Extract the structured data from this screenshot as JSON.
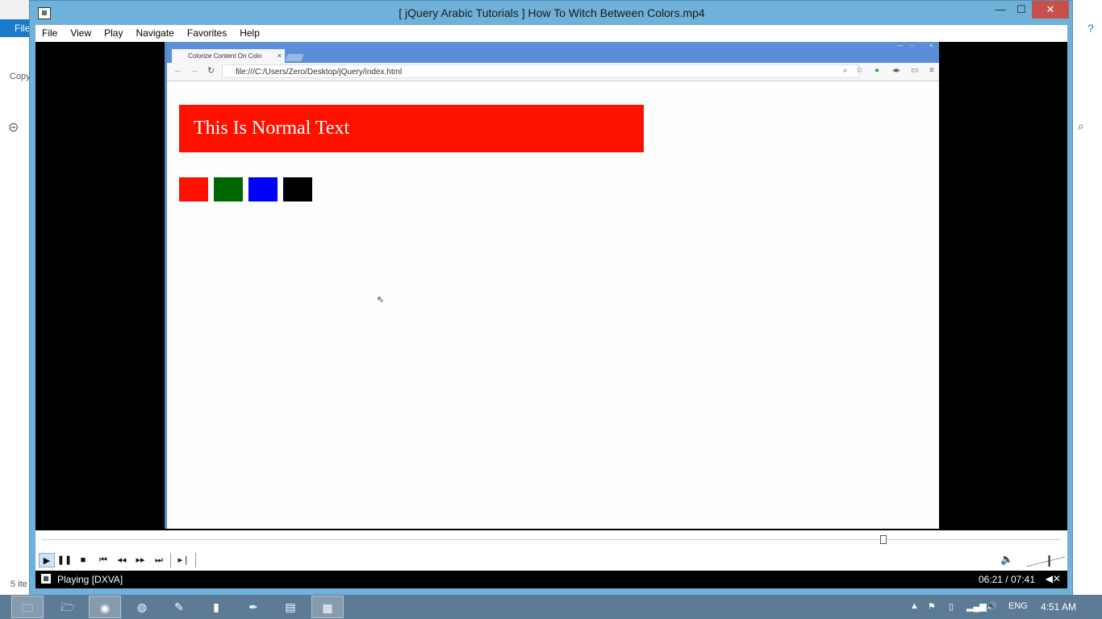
{
  "window": {
    "title": "[ jQuery Arabic Tutorials ] How To Witch Between Colors.mp4",
    "app_icon": "mpc-icon",
    "minimize": "—",
    "maximize": "☐",
    "close": "✕"
  },
  "menu": [
    "File",
    "View",
    "Play",
    "Navigate",
    "Favorites",
    "Help"
  ],
  "background_explorer": {
    "ribbon_label": "File",
    "copy_label": "Copy",
    "items_count": "5 ite"
  },
  "browser": {
    "tab_title": "Colorize Content On Colo",
    "tab_close": "×",
    "address": "file:///C:/Users/Zero/Desktop/jQuery/index.html",
    "banner_text": "This Is Normal Text",
    "swatches": [
      "#ff1100",
      "#006600",
      "#0000ff",
      "#000000"
    ]
  },
  "player": {
    "seek_fraction": 0.826,
    "status": "Playing [DXVA]",
    "time": "06:21 / 07:41",
    "volume_fraction": 0.6
  },
  "taskbar": {
    "apps": [
      "file-explorer-icon",
      "files-icon",
      "chrome-icon",
      "firefox-icon",
      "paint-icon",
      "app-icon",
      "pen-icon",
      "notepad-icon",
      "media-player-icon"
    ],
    "language": "ENG",
    "clock": "4:51 AM"
  }
}
